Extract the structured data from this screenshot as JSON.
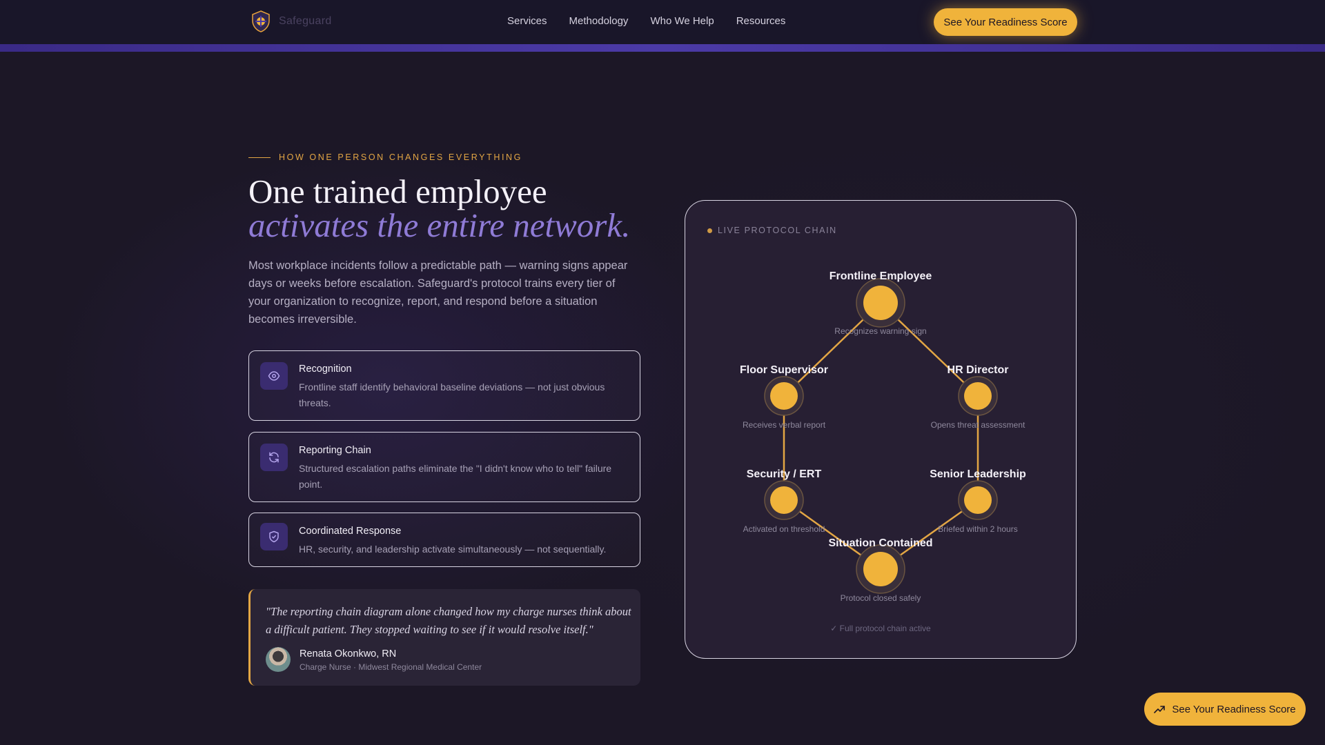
{
  "nav": {
    "logo_text": "Safeguard",
    "links": [
      "Services",
      "Methodology",
      "Who We Help",
      "Resources"
    ],
    "cta": "See Your Readiness Score"
  },
  "hero": {
    "eyebrow": "HOW ONE PERSON CHANGES EVERYTHING",
    "title_line1": "One trained employee",
    "title_line2": "activates the entire network.",
    "lead": "Most workplace incidents follow a predictable path — warning signs appear days or weeks before escalation. Safeguard's protocol trains every tier of your organization to recognize, report, and respond before a situation becomes irreversible."
  },
  "features": [
    {
      "title": "Recognition",
      "desc": "Frontline staff identify behavioral baseline deviations — not just obvious threats.",
      "icon": "eye-icon"
    },
    {
      "title": "Reporting Chain",
      "desc": "Structured escalation paths eliminate the \"I didn't know who to tell\" failure point.",
      "icon": "refresh-icon"
    },
    {
      "title": "Coordinated Response",
      "desc": "HR, security, and leadership activate simultaneously — not sequentially.",
      "icon": "shield-check-icon"
    }
  ],
  "testimonial": {
    "quote": "\"The reporting chain diagram alone changed how my charge nurses think about a difficult patient. They stopped waiting to see if it would resolve itself.\"",
    "name": "Renata Okonkwo, RN",
    "role": "Charge Nurse · Midwest Regional Medical Center"
  },
  "chain": {
    "label": "LIVE PROTOCOL CHAIN",
    "footer": "✓ Full protocol chain active",
    "nodes": [
      {
        "id": "frontline",
        "title": "Frontline Employee",
        "sub": "Recognizes warning sign"
      },
      {
        "id": "floor",
        "title": "Floor Supervisor",
        "sub": "Receives verbal report"
      },
      {
        "id": "hr",
        "title": "HR Director",
        "sub": "Opens threat assessment"
      },
      {
        "id": "security",
        "title": "Security / ERT",
        "sub": "Activated on threshold"
      },
      {
        "id": "senior",
        "title": "Senior Leadership",
        "sub": "Briefed within 2 hours"
      },
      {
        "id": "contained",
        "title": "Situation Contained",
        "sub": "Protocol closed safely"
      }
    ]
  },
  "floating_cta": "See Your Readiness Score",
  "colors": {
    "accent": "#f0b33b",
    "purple": "#8f7bd6",
    "background": "#1c1726"
  }
}
